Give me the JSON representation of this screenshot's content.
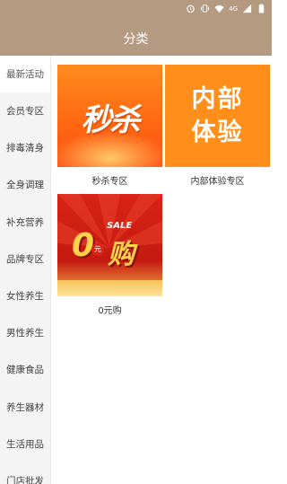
{
  "status_bar": {
    "icons": [
      "alarm-icon",
      "vibrate-icon",
      "wifi-icon",
      "signal-4g-icon",
      "signal-icon",
      "battery-icon"
    ],
    "network_label": "4G",
    "color": "#b49a80"
  },
  "header": {
    "title": "分类",
    "color": "#b49a80"
  },
  "sidebar": {
    "items": [
      {
        "label": "最新活动",
        "active": true
      },
      {
        "label": "会员专区"
      },
      {
        "label": "排毒清身"
      },
      {
        "label": "全身调理"
      },
      {
        "label": "补充营养"
      },
      {
        "label": "品牌专区"
      },
      {
        "label": "女性养生"
      },
      {
        "label": "男性养生"
      },
      {
        "label": "健康食品"
      },
      {
        "label": "养生器材"
      },
      {
        "label": "生活用品"
      },
      {
        "label": "门店批发"
      }
    ]
  },
  "content": {
    "cards": [
      {
        "caption": "秒杀专区",
        "image_text": "秒杀"
      },
      {
        "caption": "内部体验专区",
        "image_text_line1": "内部",
        "image_text_line2": "体验"
      },
      {
        "caption": "0元购",
        "image_sale": "SALE",
        "image_zero": "0",
        "image_yuan": "元",
        "image_gou": "购"
      }
    ]
  }
}
